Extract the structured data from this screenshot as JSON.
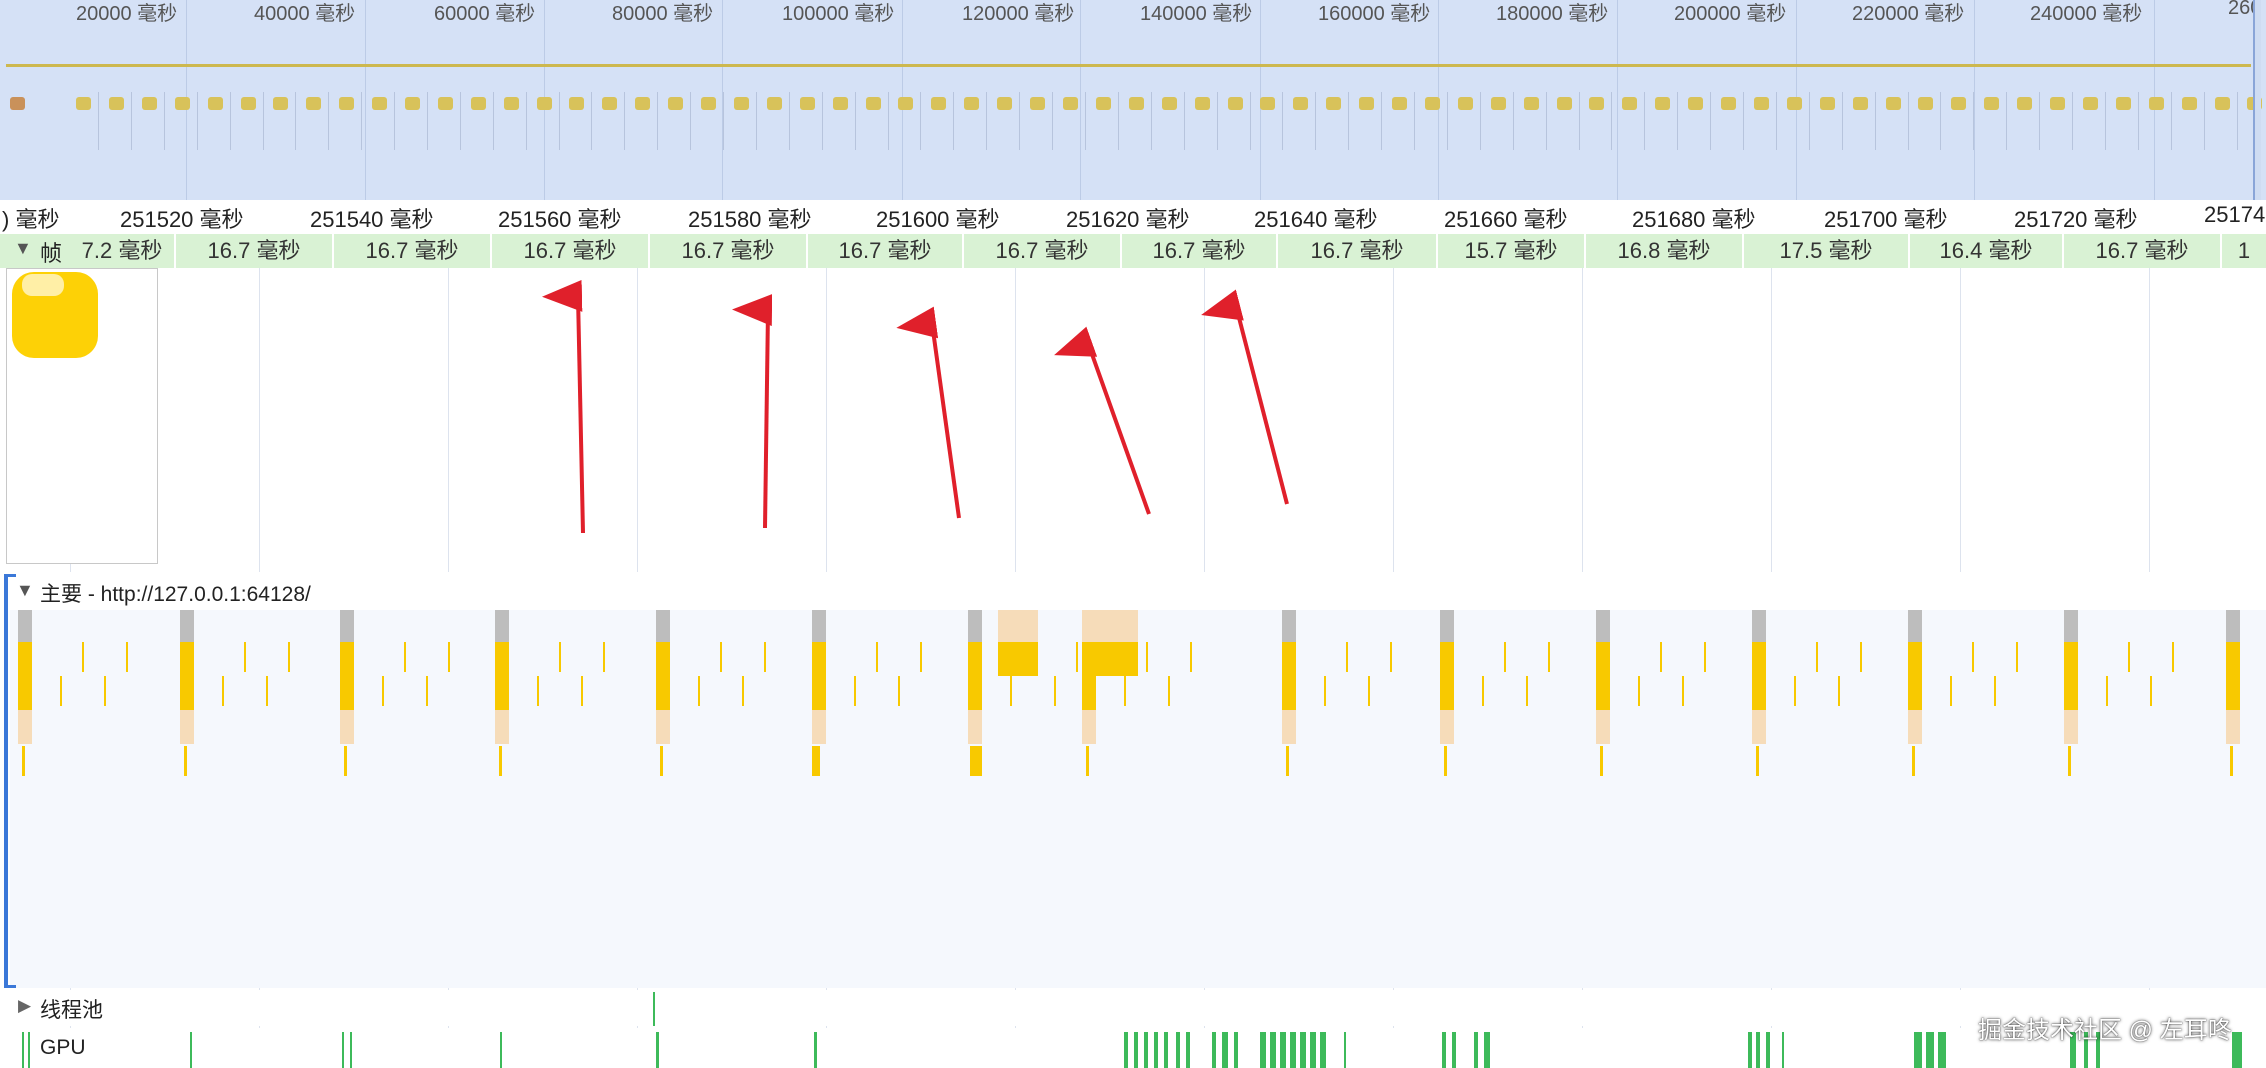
{
  "overview": {
    "tick_labels": [
      "20000 毫秒",
      "40000 毫秒",
      "60000 毫秒",
      "80000 毫秒",
      "100000 毫秒",
      "120000 毫秒",
      "140000 毫秒",
      "160000 毫秒",
      "180000 毫秒",
      "200000 毫秒",
      "220000 毫秒",
      "240000 毫秒",
      "260"
    ]
  },
  "ruler": {
    "tick_labels": [
      ") 毫秒",
      "251520 毫秒",
      "251540 毫秒",
      "251560 毫秒",
      "251580 毫秒",
      "251600 毫秒",
      "251620 毫秒",
      "251640 毫秒",
      "251660 毫秒",
      "251680 毫秒",
      "251700 毫秒",
      "251720 毫秒",
      "25174"
    ]
  },
  "frames": {
    "label": "帧",
    "toggle_icon": "▼",
    "durations": [
      "7.2 毫秒",
      "16.7 毫秒",
      "16.7 毫秒",
      "16.7 毫秒",
      "16.7 毫秒",
      "16.7 毫秒",
      "16.7 毫秒",
      "16.7 毫秒",
      "16.7 毫秒",
      "15.7 毫秒",
      "16.8 毫秒",
      "17.5 毫秒",
      "16.4 毫秒",
      "16.7 毫秒",
      "1"
    ]
  },
  "main_thread": {
    "toggle_icon": "▼",
    "title": "主要 - http://127.0.0.1:64128/"
  },
  "thread_pool": {
    "toggle_icon": "▶",
    "label": "线程池"
  },
  "gpu": {
    "label": "GPU"
  },
  "watermark": "掘金技术社区 @ 左耳咚",
  "colors": {
    "overview_bg": "#d5e1f6",
    "frame_bg": "#d9f2d4",
    "scripting": "#f8c900",
    "rendering_light": "#f6dcb9",
    "system_gray": "#bdbdbd",
    "gpu_green": "#3dba5a",
    "arrow_red": "#e0202b",
    "track_bracket": "#3b78d8"
  },
  "icons": [
    "triangle-down-icon",
    "triangle-right-icon",
    "red-arrow-annotation"
  ]
}
